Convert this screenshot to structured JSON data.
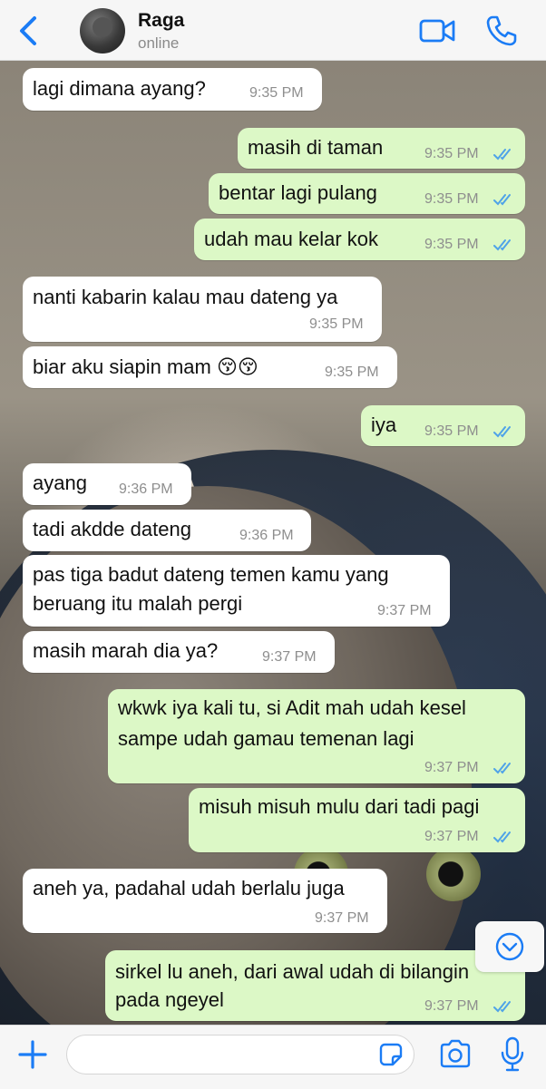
{
  "header": {
    "contact_name": "Raga",
    "contact_status": "online"
  },
  "accent_color": "#1b7cf5",
  "icons": [
    "chevron-left-icon",
    "video-camera-icon",
    "phone-icon",
    "chevron-down-icon",
    "plus-icon",
    "sticker-icon",
    "camera-icon",
    "microphone-icon",
    "double-check-icon"
  ],
  "messages": [
    {
      "dir": "in",
      "text": "lagi dimana ayang?",
      "time": "9:35 PM"
    },
    {
      "dir": "out",
      "text": "masih di taman",
      "time": "9:35 PM",
      "read": true
    },
    {
      "dir": "out",
      "text": "bentar lagi pulang",
      "time": "9:35 PM",
      "read": true
    },
    {
      "dir": "out",
      "text": "udah mau kelar kok",
      "time": "9:35 PM",
      "read": true
    },
    {
      "dir": "in",
      "text": "nanti kabarin kalau mau dateng ya",
      "time": "9:35 PM"
    },
    {
      "dir": "in",
      "text": "biar aku siapin mam 😚😚",
      "time": "9:35 PM"
    },
    {
      "dir": "out",
      "text": "iya",
      "time": "9:35 PM",
      "read": true
    },
    {
      "dir": "in",
      "text": "ayang",
      "time": "9:36 PM"
    },
    {
      "dir": "in",
      "text": "tadi akdde dateng",
      "time": "9:36 PM"
    },
    {
      "dir": "in",
      "lines": [
        "pas tiga badut dateng temen kamu yang",
        "beruang itu malah pergi"
      ],
      "time": "9:37 PM"
    },
    {
      "dir": "in",
      "text": "masih marah dia ya?",
      "time": "9:37 PM"
    },
    {
      "dir": "out",
      "lines": [
        "wkwk iya kali tu, si Adit mah udah kesel",
        "sampe udah gamau temenan lagi"
      ],
      "time": "9:37 PM",
      "read": true
    },
    {
      "dir": "out",
      "text": "misuh misuh mulu dari tadi pagi",
      "time": "9:37 PM",
      "read": true
    },
    {
      "dir": "in",
      "text": "aneh ya, padahal udah berlalu juga",
      "time": "9:37 PM"
    },
    {
      "dir": "out",
      "lines": [
        "sirkel lu aneh, dari awal udah di bilangin",
        "pada ngeyel"
      ],
      "time": "9:37 PM",
      "read": true
    }
  ],
  "composer": {
    "value": "",
    "placeholder": ""
  }
}
